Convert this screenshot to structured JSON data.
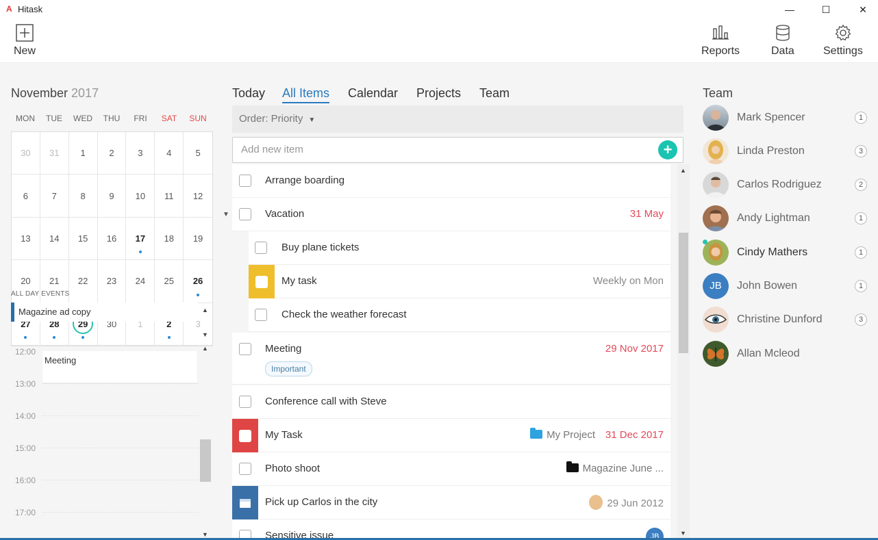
{
  "app": {
    "title": "Hitask",
    "logo_glyph": "A"
  },
  "window_controls": {
    "minimize": "—",
    "maximize": "☐",
    "close": "✕"
  },
  "toolbar": {
    "new_label": "New",
    "reports_label": "Reports",
    "data_label": "Data",
    "settings_label": "Settings"
  },
  "calendar": {
    "month": "November",
    "year": "2017",
    "weekdays": [
      "MON",
      "TUE",
      "WED",
      "THU",
      "FRI",
      "SAT",
      "SUN"
    ],
    "weeks": [
      [
        "30",
        "31",
        "1",
        "2",
        "3",
        "4",
        "5"
      ],
      [
        "6",
        "7",
        "8",
        "9",
        "10",
        "11",
        "12"
      ],
      [
        "13",
        "14",
        "15",
        "16",
        "17",
        "18",
        "19"
      ],
      [
        "20",
        "21",
        "22",
        "23",
        "24",
        "25",
        "26"
      ],
      [
        "27",
        "28",
        "29",
        "30",
        "1",
        "2",
        "3"
      ]
    ],
    "all_day_label": "ALL DAY EVENTS",
    "all_day_event": "Magazine ad copy",
    "hours": [
      "12:00",
      "13:00",
      "14:00",
      "15:00",
      "16:00",
      "17:00"
    ],
    "meeting_block": "Meeting"
  },
  "tabs": [
    "Today",
    "All Items",
    "Calendar",
    "Projects",
    "Team"
  ],
  "order_label": "Order: Priority",
  "add_item_placeholder": "Add new item",
  "add_item_plus": "+",
  "items": {
    "arrange": "Arrange boarding",
    "vacation": "Vacation",
    "vacation_date": "31 May",
    "plane": "Buy plane tickets",
    "mytask1": "My task",
    "mytask1_repeat": "Weekly on Mon",
    "weather": "Check the weather forecast",
    "meeting": "Meeting",
    "meeting_date": "29 Nov 2017",
    "meeting_tag": "Important",
    "conference": "Conference call with Steve",
    "mytask2": "My Task",
    "mytask2_project": "My Project",
    "mytask2_date": "31 Dec 2017",
    "photo": "Photo shoot",
    "photo_project": "Magazine June ...",
    "pickup": "Pick up Carlos in the city",
    "pickup_date": "29 Jun 2012",
    "sensitive": "Sensitive issue",
    "sensitive_avatar": "JB"
  },
  "team": {
    "title": "Team",
    "members": [
      {
        "name": "Mark Spencer",
        "count": "1"
      },
      {
        "name": "Linda Preston",
        "count": "3"
      },
      {
        "name": "Carlos Rodriguez",
        "count": "2"
      },
      {
        "name": "Andy Lightman",
        "count": "1"
      },
      {
        "name": "Cindy Mathers",
        "count": "1"
      },
      {
        "name": "John Bowen",
        "count": "1",
        "initials": "JB"
      },
      {
        "name": "Christine Dunford",
        "count": "3"
      },
      {
        "name": "Allan Mcleod",
        "count": ""
      }
    ]
  },
  "colors": {
    "accent": "#2a7bc0",
    "teal": "#1bc4b0",
    "date_red": "#e24a5a",
    "yellow": "#efbe2c",
    "red": "#e04545",
    "blue": "#3a70a8"
  }
}
